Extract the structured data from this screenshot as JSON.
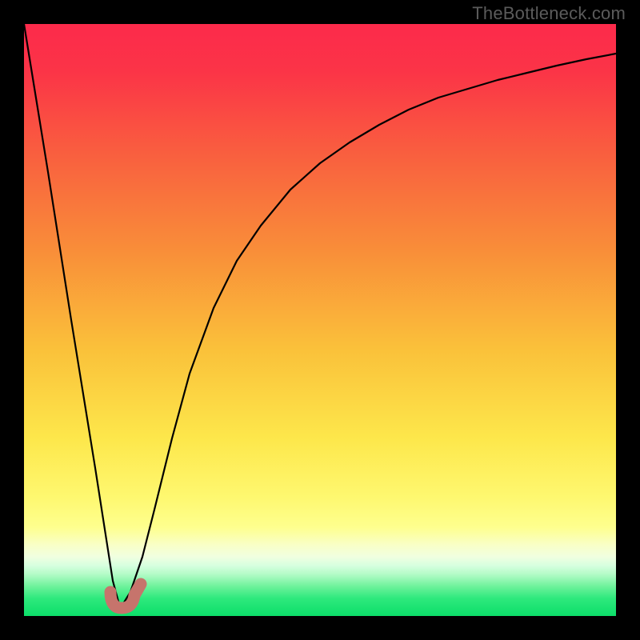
{
  "watermark": "TheBottleneck.com",
  "colors": {
    "frame": "#000000",
    "gradient_top": "#fc2a4b",
    "gradient_mid_upper": "#f97d3a",
    "gradient_mid": "#fbd138",
    "gradient_mid_lower": "#fdf65a",
    "gradient_band": "#f9ffc7",
    "gradient_bottom": "#0ee36f",
    "curve": "#000000",
    "marker_fill": "#c6746c",
    "marker_alt": "#c06860"
  },
  "chart_data": {
    "type": "line",
    "title": "",
    "xlabel": "",
    "ylabel": "",
    "xlim": [
      0,
      100
    ],
    "ylim": [
      0,
      100
    ],
    "grid": false,
    "legend": false,
    "note": "No numeric axes or ticks shown; values are relative to the plot area extent.",
    "series": [
      {
        "name": "left-branch",
        "x": [
          0,
          4,
          8,
          12,
          15,
          16,
          16.5
        ],
        "y": [
          100,
          75,
          50,
          25,
          6,
          2,
          1.5
        ]
      },
      {
        "name": "right-branch",
        "x": [
          16.5,
          18,
          20,
          22,
          25,
          28,
          32,
          36,
          40,
          45,
          50,
          55,
          60,
          65,
          70,
          75,
          80,
          85,
          90,
          95,
          100
        ],
        "y": [
          1.5,
          4,
          10,
          18,
          30,
          41,
          52,
          60,
          66,
          72,
          76.5,
          80,
          83,
          85.5,
          87.5,
          89,
          90.5,
          91.8,
          93,
          94,
          95
        ]
      }
    ],
    "marker": {
      "name": "J-marker",
      "description": "small curved J-shaped stroke near the minimum",
      "x_range": [
        14.5,
        19.5
      ],
      "y_range": [
        1.0,
        4.5
      ]
    }
  }
}
